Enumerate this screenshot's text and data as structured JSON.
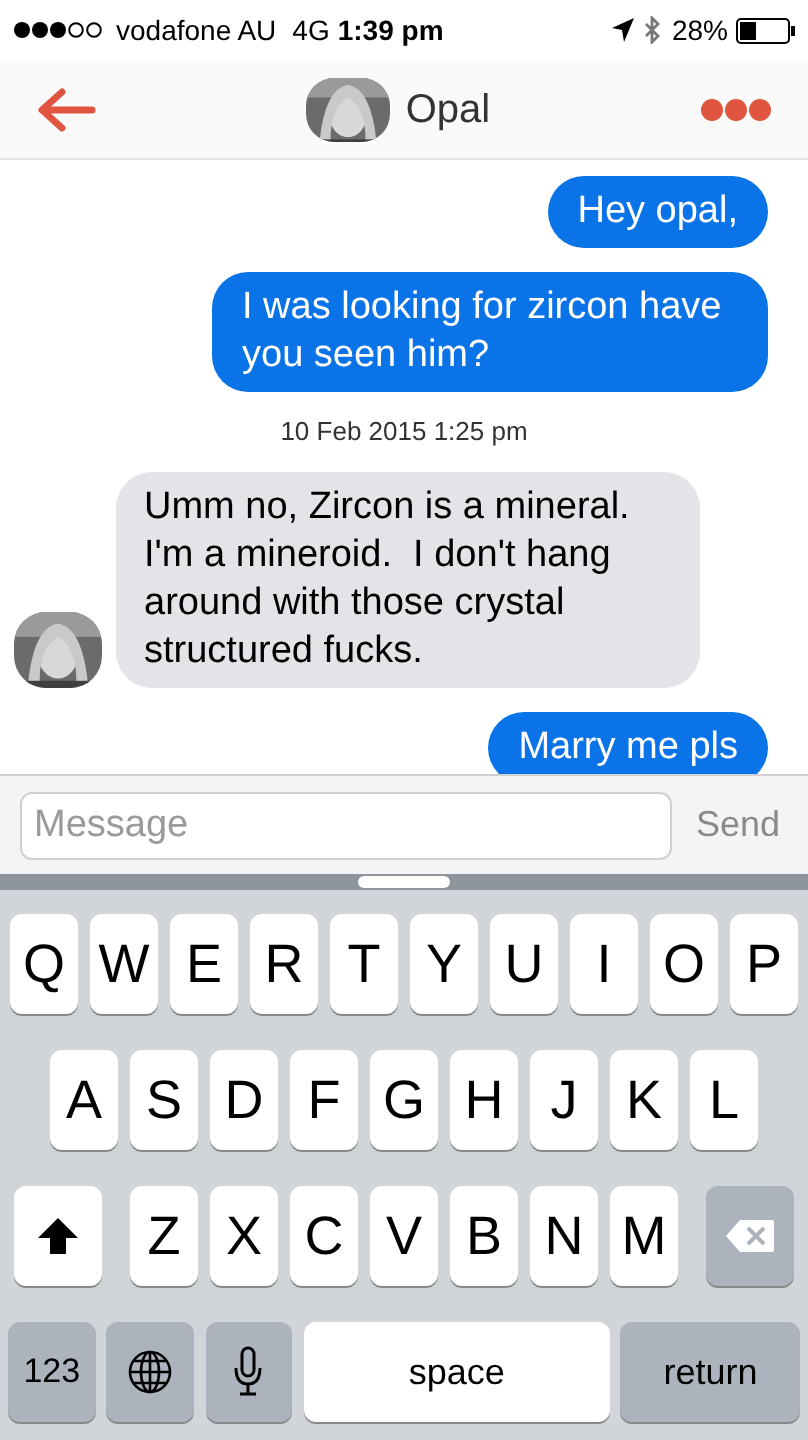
{
  "status_bar": {
    "carrier": "vodafone AU",
    "network": "4G",
    "time": "1:39 pm",
    "battery": "28%"
  },
  "header": {
    "title": "Opal"
  },
  "messages": [
    {
      "kind": "sent",
      "text": "Hey opal,"
    },
    {
      "kind": "sent",
      "text": "I was looking for zircon have you seen him?"
    },
    {
      "kind": "timestamp",
      "text": "10 Feb 2015 1:25 pm"
    },
    {
      "kind": "received",
      "text": "Umm no, Zircon is a mineral. I'm a mineroid.  I don't hang around with those crystal structured fucks."
    },
    {
      "kind": "sent",
      "text": "Marry me pls"
    }
  ],
  "composer": {
    "placeholder": "Message",
    "send": "Send"
  },
  "keyboard": {
    "letter_rows": [
      [
        {
          "kind": "letter",
          "label": "Q"
        },
        {
          "kind": "letter",
          "label": "W"
        },
        {
          "kind": "letter",
          "label": "E"
        },
        {
          "kind": "letter",
          "label": "R"
        },
        {
          "kind": "letter",
          "label": "T"
        },
        {
          "kind": "letter",
          "label": "Y"
        },
        {
          "kind": "letter",
          "label": "U"
        },
        {
          "kind": "letter",
          "label": "I"
        },
        {
          "kind": "letter",
          "label": "O"
        },
        {
          "kind": "letter",
          "label": "P"
        }
      ],
      [
        {
          "kind": "letter",
          "label": "A"
        },
        {
          "kind": "letter",
          "label": "S"
        },
        {
          "kind": "letter",
          "label": "D"
        },
        {
          "kind": "letter",
          "label": "F"
        },
        {
          "kind": "letter",
          "label": "G"
        },
        {
          "kind": "letter",
          "label": "H"
        },
        {
          "kind": "letter",
          "label": "J"
        },
        {
          "kind": "letter",
          "label": "K"
        },
        {
          "kind": "letter",
          "label": "L"
        }
      ],
      [
        {
          "kind": "shift"
        },
        {
          "kind": "letter",
          "label": "Z"
        },
        {
          "kind": "letter",
          "label": "X"
        },
        {
          "kind": "letter",
          "label": "C"
        },
        {
          "kind": "letter",
          "label": "V"
        },
        {
          "kind": "letter",
          "label": "B"
        },
        {
          "kind": "letter",
          "label": "N"
        },
        {
          "kind": "letter",
          "label": "M"
        },
        {
          "kind": "delete"
        }
      ]
    ],
    "bottom_row": [
      {
        "kind": "numbers",
        "label": "123"
      },
      {
        "kind": "globe"
      },
      {
        "kind": "mic"
      },
      {
        "kind": "space",
        "label": "space"
      },
      {
        "kind": "return",
        "label": "return"
      }
    ]
  }
}
